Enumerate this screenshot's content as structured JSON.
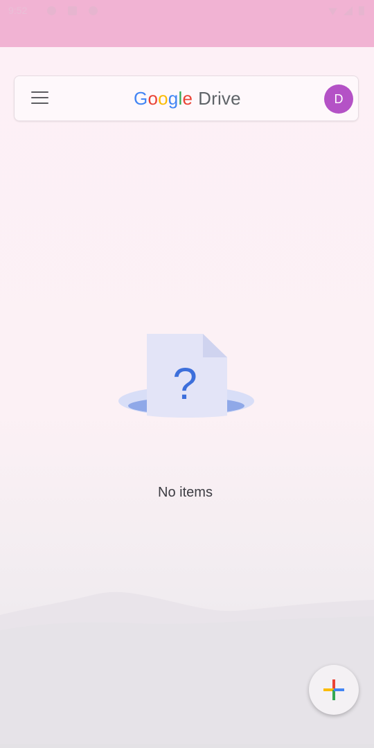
{
  "status_bar": {
    "time": "9:52",
    "bg_color": "#f1b3d3"
  },
  "search_bar": {
    "menu_icon": "hamburger-menu-icon",
    "logo": {
      "google_letters": [
        {
          "char": "G",
          "color": "#4285f4"
        },
        {
          "char": "o",
          "color": "#ea4335"
        },
        {
          "char": "o",
          "color": "#fbbc05"
        },
        {
          "char": "g",
          "color": "#4285f4"
        },
        {
          "char": "l",
          "color": "#34a853"
        },
        {
          "char": "e",
          "color": "#ea4335"
        }
      ],
      "product": "Drive"
    },
    "avatar_initial": "D",
    "avatar_color": "#b452c6"
  },
  "empty_state": {
    "icon": "question-document-icon",
    "message": "No items"
  },
  "fab": {
    "icon": "plus-icon",
    "colors": [
      "#ea4335",
      "#fbbc05",
      "#34a853",
      "#4285f4"
    ]
  }
}
